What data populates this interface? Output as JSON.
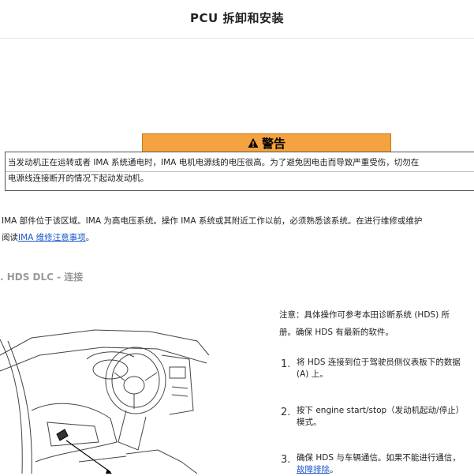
{
  "page": {
    "title": "PCU 拆卸和安装"
  },
  "warning": {
    "heading": "警告",
    "line1": "当发动机正在运转或者 IMA 系统通电时，IMA 电机电源线的电压很高。为了避免因电击而导致严重受伤，切勿在",
    "line2": "电源线连接断开的情况下起动发动机。"
  },
  "intro": {
    "line1": "IMA 部件位于该区域。IMA 为高电压系统。操作 IMA 系统或其附近工作以前，必须熟悉该系统。在进行维修或维护",
    "line2_prefix": "阅读",
    "line2_link": "IMA 维修注意事项",
    "line2_suffix": "。"
  },
  "section": {
    "title": ". HDS DLC - 连接"
  },
  "note": {
    "line1": "注意：具体操作可参考本田诊断系统 (HDS) 所",
    "line2": "册。确保 HDS 有最新的软件。"
  },
  "steps": [
    {
      "num": "1.",
      "line1": "将 HDS 连接到位于驾驶员侧仪表板下的数据",
      "line2": "(A) 上。"
    },
    {
      "num": "2.",
      "line1": "按下 engine start/stop（发动机起动/停止）",
      "line2": "模式。"
    },
    {
      "num": "3.",
      "line1": "确保 HDS 与车辆通信。如果不能进行通信，",
      "line2_link": "故障排除",
      "line2_suffix": "。"
    }
  ],
  "colors": {
    "warning_bg": "#f4a340",
    "link": "#1a56c8",
    "section": "#999999"
  },
  "illustration": {
    "label": "dashboard-dlc-location-illustration"
  }
}
